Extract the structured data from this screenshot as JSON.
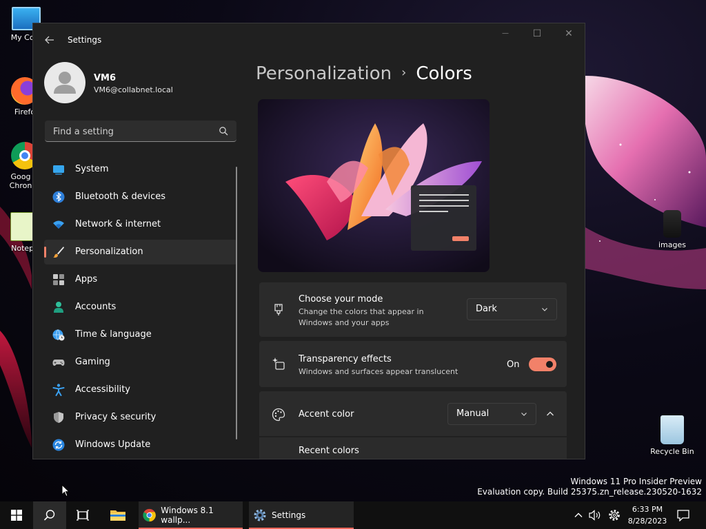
{
  "desktop": {
    "icons": [
      {
        "label": "My Com"
      },
      {
        "label": "Firefo"
      },
      {
        "label": "Goog Chron"
      },
      {
        "label": "Notepa"
      },
      {
        "label": "images"
      },
      {
        "label": "Recycle Bin"
      }
    ],
    "watermark_line1": "Windows 11 Pro Insider Preview",
    "watermark_line2": "Evaluation copy. Build 25375.zn_release.230520-1632"
  },
  "window": {
    "title": "Settings",
    "controls": {
      "minimize": "—",
      "maximize": "☐",
      "close": "✕"
    }
  },
  "profile": {
    "name": "VM6",
    "email": "VM6@collabnet.local"
  },
  "search": {
    "placeholder": "Find a setting"
  },
  "nav": [
    {
      "label": "System"
    },
    {
      "label": "Bluetooth & devices"
    },
    {
      "label": "Network & internet"
    },
    {
      "label": "Personalization"
    },
    {
      "label": "Apps"
    },
    {
      "label": "Accounts"
    },
    {
      "label": "Time & language"
    },
    {
      "label": "Gaming"
    },
    {
      "label": "Accessibility"
    },
    {
      "label": "Privacy & security"
    },
    {
      "label": "Windows Update"
    }
  ],
  "breadcrumb": {
    "parent": "Personalization",
    "separator": "›",
    "current": "Colors"
  },
  "mode": {
    "title": "Choose your mode",
    "description": "Change the colors that appear in Windows and your apps",
    "value": "Dark"
  },
  "transparency": {
    "title": "Transparency effects",
    "description": "Windows and surfaces appear translucent",
    "state": "On"
  },
  "accent": {
    "title": "Accent color",
    "value": "Manual",
    "recent_colors_label": "Recent colors"
  },
  "colors": {
    "accent": "#f28169",
    "window_bg": "#202020",
    "card_bg": "#2b2b2b",
    "taskbar_bg": "#101010"
  },
  "taskbar": {
    "chrome_label": "Windows 8.1 wallp...",
    "settings_label": "Settings",
    "time": "6:33 PM",
    "date": "8/28/2023"
  }
}
